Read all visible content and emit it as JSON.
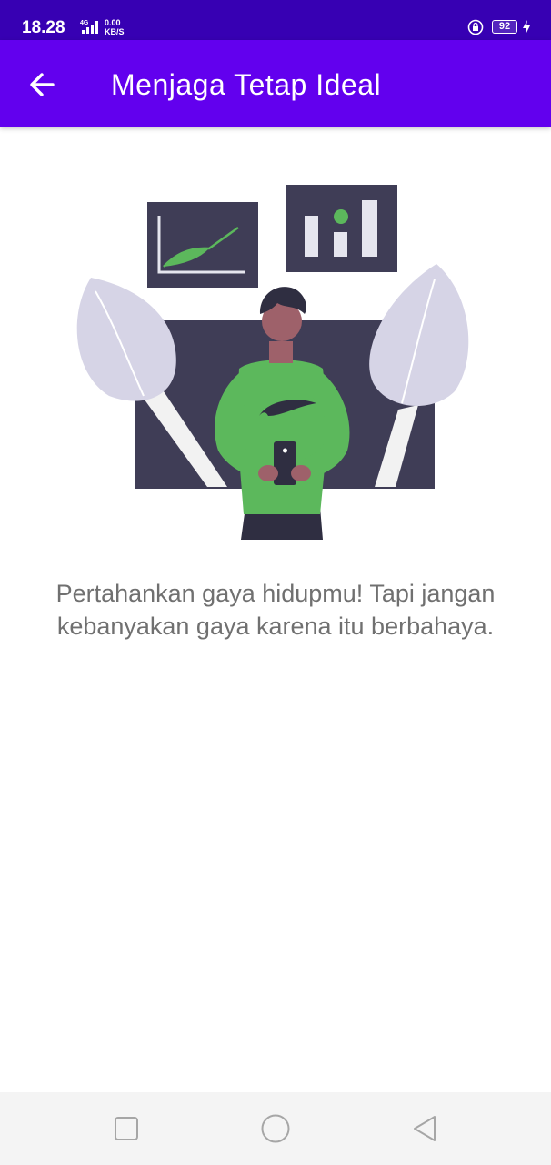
{
  "status_bar": {
    "time": "18.28",
    "network_type": "4G",
    "net_speed_value": "0.00",
    "net_speed_unit": "KB/S",
    "battery_level": "92"
  },
  "app_bar": {
    "title": "Menjaga Tetap Ideal",
    "back_icon": "arrow-left-icon",
    "background_color": "#6200ee"
  },
  "content": {
    "illustration": "person-with-phone-and-charts-illustration",
    "caption_line1": "Pertahankan gaya hidupmu! Tapi jangan",
    "caption_line2": "kebanyakan gaya karena itu berbahaya."
  },
  "nav_bar": {
    "recent_icon": "square-recent-apps-icon",
    "home_icon": "circle-home-icon",
    "back_icon": "triangle-back-icon"
  },
  "colors": {
    "status_bar": "#3700b3",
    "accent_green": "#5cb85c",
    "dark_slate": "#3f3d56",
    "caption_text": "#707070"
  }
}
